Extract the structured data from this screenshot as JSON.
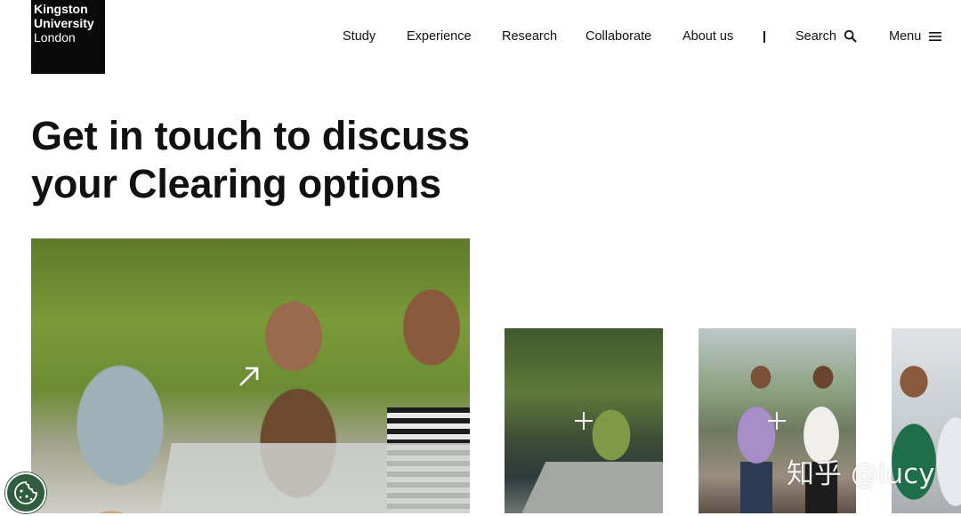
{
  "logo": {
    "line1": "Kingston",
    "line2": "University",
    "line3": "London"
  },
  "nav": {
    "items": [
      "Study",
      "Experience",
      "Research",
      "Collaborate",
      "About us"
    ],
    "search_label": "Search",
    "menu_label": "Menu"
  },
  "hero": {
    "title_line1": "Get in touch to discuss",
    "title_line2": "your Clearing options"
  },
  "icons": {
    "search": "search-icon",
    "menu": "hamburger-menu-icon",
    "arrow": "arrow-up-right-icon",
    "plus": "plus-icon",
    "cookie": "cookie-icon"
  },
  "colors": {
    "logo_bg": "#0a0a0a",
    "text": "#111111",
    "cookie_bg": "#2f5d3d"
  },
  "watermark": "知乎 @lucy"
}
